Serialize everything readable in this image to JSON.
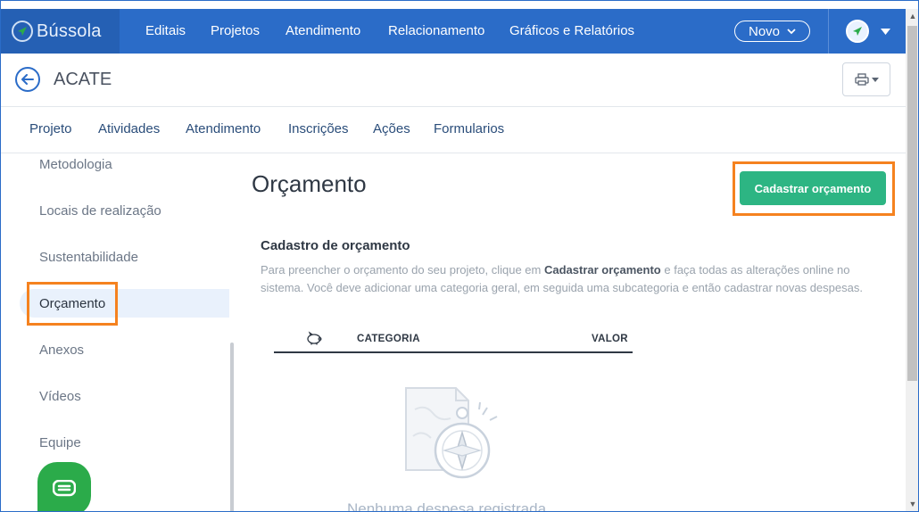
{
  "app": {
    "logo_text": "Bússola",
    "brand_color": "#2b6cc8",
    "accent_green": "#2db583",
    "highlight_color": "#f5821f"
  },
  "topnav": {
    "items": [
      "Editais",
      "Projetos",
      "Atendimento",
      "Relacionamento",
      "Gráficos e Relatórios"
    ],
    "new_button": "Novo",
    "avatar_icon": "compass-icon"
  },
  "header": {
    "title": "ACATE",
    "back_icon": "arrow-left-icon",
    "print_icon": "printer-icon"
  },
  "tabs": [
    "Projeto",
    "Atividades",
    "Atendimento",
    "Inscrições",
    "Ações",
    "Formularios"
  ],
  "sidebar": {
    "items": [
      "Metodologia",
      "Locais de realização",
      "Sustentabilidade",
      "Orçamento",
      "Anexos",
      "Vídeos",
      "Equipe"
    ],
    "active": "Orçamento"
  },
  "main": {
    "title": "Orçamento",
    "primary_button": "Cadastrar orçamento",
    "section_title": "Cadastro de orçamento",
    "desc_prefix": "Para preencher o orçamento do seu projeto, clique em ",
    "desc_bold": "Cadastrar orçamento",
    "desc_suffix": " e faça todas as alterações online no sistema. Você deve adicionar uma categoria geral, em seguida uma subcategoria e então cadastrar novas despesas.",
    "table_headers": {
      "icon": "piggy-bank-icon",
      "category": "CATEGORIA",
      "value": "VALOR"
    },
    "empty_text": "Nenhuma despesa registrada"
  },
  "chat": {
    "icon": "chat-icon"
  }
}
